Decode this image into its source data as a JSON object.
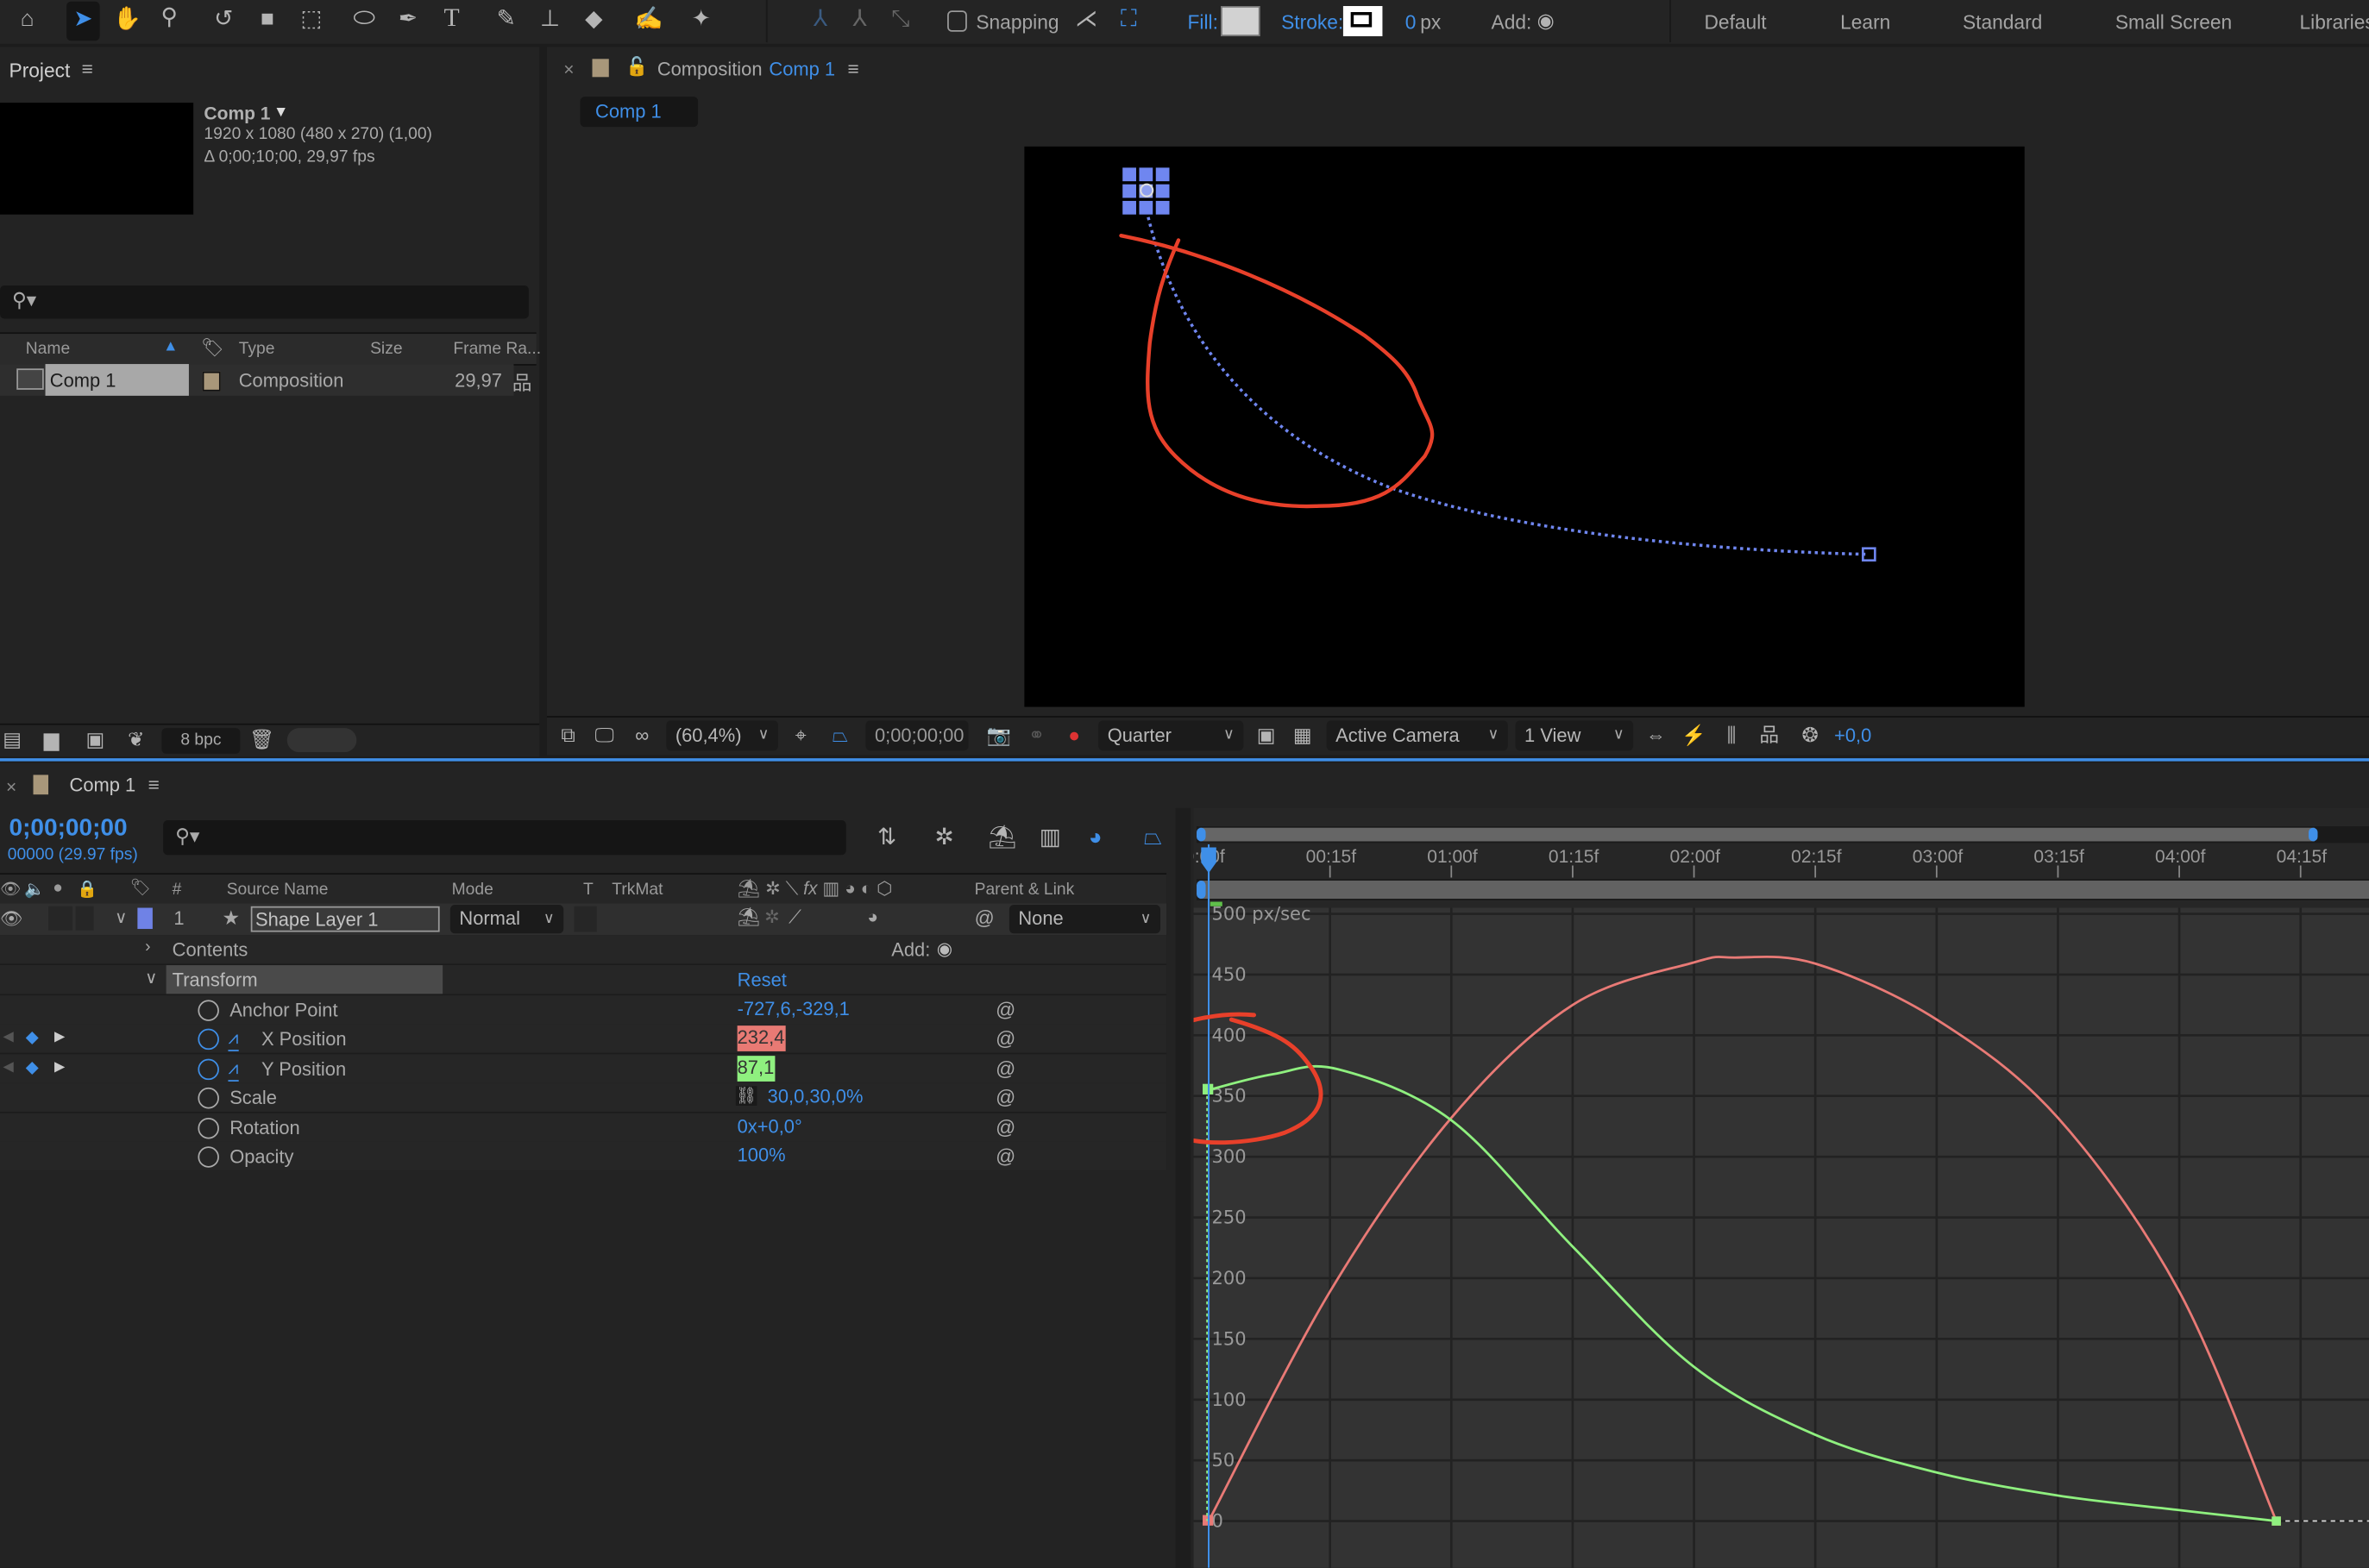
{
  "toolbar": {
    "tools": [
      "home-icon",
      "selection-tool-icon",
      "hand-tool-icon",
      "zoom-tool-icon",
      "rotate-tool-icon",
      "camera-tool-icon",
      "pan-behind-tool-icon",
      "ellipse-tool-icon",
      "pen-tool-icon",
      "type-tool-icon",
      "brush-tool-icon",
      "clone-stamp-tool-icon",
      "eraser-tool-icon",
      "roto-brush-tool-icon",
      "puppet-tool-icon"
    ],
    "snapping_label": "Snapping",
    "snapping_checked": false,
    "fill_label": "Fill:",
    "fill_color": "#d2d2d2",
    "stroke_label": "Stroke:",
    "stroke_value": "0",
    "stroke_unit": "px",
    "add_label": "Add:",
    "workspaces": [
      "Default",
      "Learn",
      "Standard",
      "Small Screen",
      "Libraries"
    ]
  },
  "project": {
    "title": "Project",
    "item_name": "Comp 1",
    "item_size": "1920 x 1080  (480 x 270) (1,00)",
    "item_duration": "Δ 0;00;10;00, 29,97 fps",
    "search_placeholder": "",
    "columns": [
      "Name",
      "Type",
      "Size",
      "Frame Ra..."
    ],
    "rows": [
      {
        "name": "Comp 1",
        "type": "Composition",
        "size": "",
        "frame_rate": "29,97",
        "label_color": "#a8977a"
      }
    ],
    "bit_depth": "8 bpc"
  },
  "composition": {
    "title_prefix": "Composition",
    "title_name": "Comp 1",
    "tab": "Comp 1",
    "label_color": "#a8977a",
    "zoom": "(60,4%)",
    "timecode": "0;00;00;00",
    "resolution": "Quarter",
    "camera": "Active Camera",
    "views": "1 View",
    "exposure": "+0,0"
  },
  "timeline": {
    "tab": "Comp 1",
    "timecode": "0;00;00;00",
    "frame_info": "00000 (29.97 fps)",
    "columns": {
      "number": "#",
      "source_name": "Source Name",
      "mode": "Mode",
      "t": "T",
      "trkmat": "TrkMat",
      "parent": "Parent & Link"
    },
    "layer": {
      "number": "1",
      "name": "Shape Layer 1",
      "mode": "Normal",
      "parent": "None",
      "label_color": "#6f82e6"
    },
    "contents_label": "Contents",
    "add_label": "Add:",
    "transform_label": "Transform",
    "reset_label": "Reset",
    "properties": [
      {
        "name": "Anchor Point",
        "value": "-727,6,-329,1"
      },
      {
        "name": "X Position",
        "value": "232,4",
        "highlight": "#e87a74"
      },
      {
        "name": "Y Position",
        "value": "87,1",
        "highlight": "#8ff07f"
      },
      {
        "name": "Scale",
        "value": "30,0,30,0%"
      },
      {
        "name": "Rotation",
        "value": "0x+0,0°"
      },
      {
        "name": "Opacity",
        "value": "100%"
      }
    ]
  },
  "chart_data": {
    "type": "line",
    "title": "",
    "ylabel": "px/sec",
    "y_top_label": "500 px/sec",
    "ylim": [
      0,
      500
    ],
    "y_ticks": [
      "0",
      "50",
      "100",
      "150",
      "200",
      "250",
      "300",
      "350",
      "400",
      "450"
    ],
    "x_ticks": [
      "0:00f",
      "00:15f",
      "01:00f",
      "01:15f",
      "02:00f",
      "02:15f",
      "03:00f",
      "03:15f",
      "04:00f",
      "04:15f"
    ],
    "x_unit": "frames",
    "grid": true,
    "series": [
      {
        "color": "#e97a76",
        "x": [
          0,
          15,
          30,
          45,
          60,
          65,
          75,
          90,
          105,
          120,
          132
        ],
        "values": [
          0,
          189,
          332,
          425,
          460,
          464,
          459,
          413,
          332,
          189,
          0
        ]
      },
      {
        "color": "#8ff07f",
        "x": [
          0,
          8,
          16,
          30,
          45,
          60,
          75,
          90,
          105,
          120,
          132
        ],
        "values": [
          355,
          368,
          372,
          330,
          226,
          127,
          71,
          40,
          21,
          9,
          0
        ]
      }
    ]
  }
}
